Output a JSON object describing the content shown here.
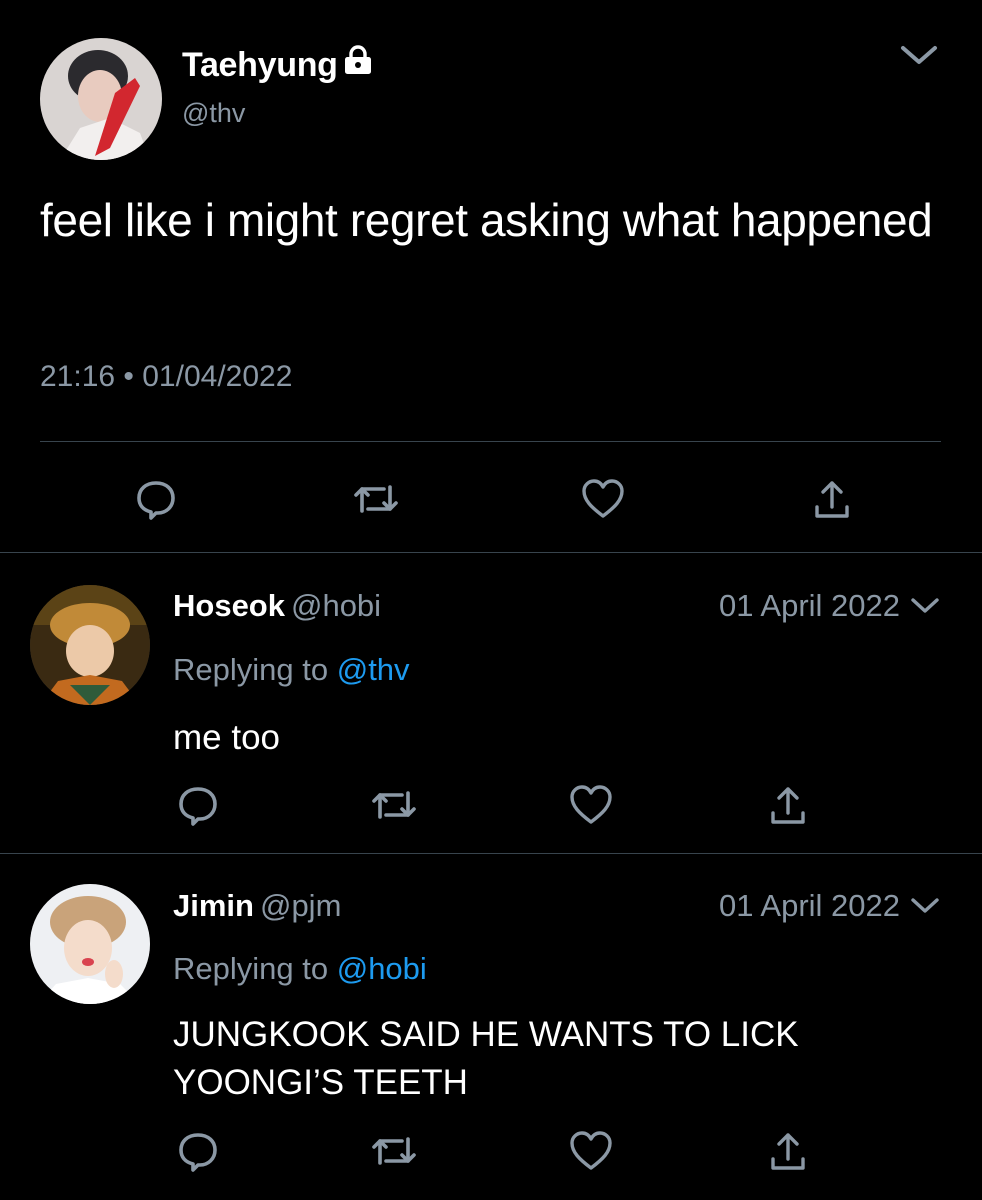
{
  "main_tweet": {
    "name": "Taehyung",
    "handle": "@thv",
    "text": "feel like i might regret asking what happened",
    "timestamp": "21:16 • 01/04/2022",
    "icons": [
      "lock-icon",
      "chevron-down-icon",
      "reply-icon",
      "retweet-icon",
      "like-icon",
      "share-icon"
    ]
  },
  "replies": [
    {
      "name": "Hoseok",
      "handle": "@hobi",
      "date": "01 April 2022",
      "replying_prefix": "Replying to",
      "replying_to": "@thv",
      "text": "me too"
    },
    {
      "name": "Jimin",
      "handle": "@pjm",
      "date": "01 April 2022",
      "replying_prefix": "Replying to",
      "replying_to": "@hobi",
      "text": "JUNGKOOK SAID HE WANTS TO LICK YOONGI’S TEETH"
    }
  ],
  "colors": {
    "background": "#000000",
    "text_primary": "#ffffff",
    "text_secondary": "#8b98a5",
    "mention": "#1d9bf0",
    "divider": "#38444d"
  }
}
